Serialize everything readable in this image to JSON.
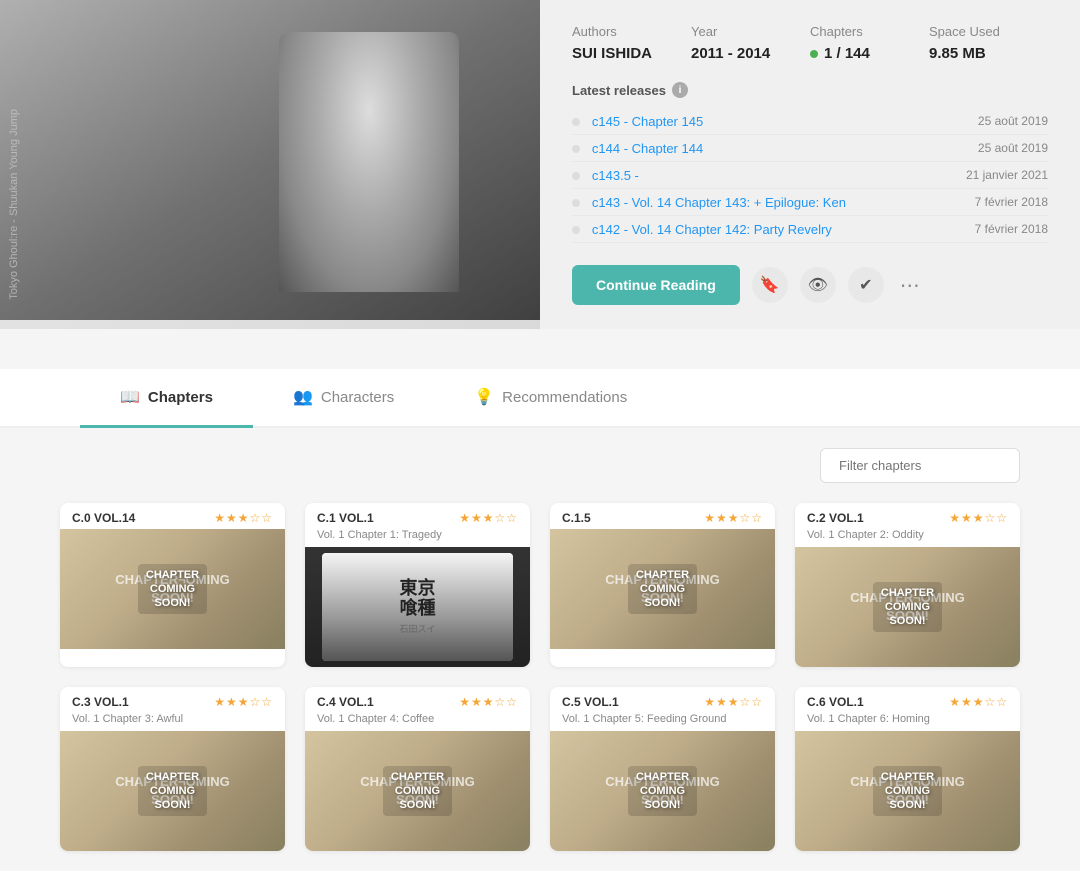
{
  "hero": {
    "cover_alt": "Tokyo Ghoul:re - Shuukan Young Jump",
    "cover_text": "Tokyo Ghoul:re - Shuukan Young Jump",
    "meta": {
      "authors_label": "Authors",
      "authors_value": "SUI ISHIDA",
      "year_label": "Year",
      "year_value": "2011 - 2014",
      "chapters_label": "Chapters",
      "chapters_value": "1 / 144",
      "space_label": "Space Used",
      "space_value": "9.85 MB"
    },
    "latest_releases_label": "Latest releases",
    "releases": [
      {
        "id": "c145",
        "label": "c145 - Chapter 145",
        "date": "25 août 2019"
      },
      {
        "id": "c144",
        "label": "c144 - Chapter 144",
        "date": "25 août 2019"
      },
      {
        "id": "c143_5",
        "label": "c143.5 -",
        "date": "21 janvier 2021"
      },
      {
        "id": "c143",
        "label": "c143 - Vol. 14 Chapter 143: + Epilogue: Ken",
        "date": "7 février 2018"
      },
      {
        "id": "c142",
        "label": "c142 - Vol. 14 Chapter 142: Party Revelry",
        "date": "7 février 2018"
      }
    ],
    "continue_reading_label": "Continue Reading",
    "more_options": "⋯"
  },
  "tabs": [
    {
      "id": "chapters",
      "label": "Chapters",
      "icon": "📖",
      "active": true
    },
    {
      "id": "characters",
      "label": "Characters",
      "icon": "👥",
      "active": false
    },
    {
      "id": "recommendations",
      "label": "Recommendations",
      "icon": "💡",
      "active": false
    }
  ],
  "filter_placeholder": "Filter chapters",
  "chapters": [
    {
      "num": "C.0 VOL.14",
      "title": "",
      "stars": "★★★☆☆",
      "type": "coming_soon"
    },
    {
      "num": "C.1 VOL.1",
      "title": "Vol. 1 Chapter 1: Tragedy",
      "stars": "★★★☆☆",
      "type": "manga_cover"
    },
    {
      "num": "C.1.5",
      "title": "",
      "stars": "★★★☆☆",
      "type": "coming_soon"
    },
    {
      "num": "C.2 VOL.1",
      "title": "Vol. 1 Chapter 2: Oddity",
      "stars": "★★★☆☆",
      "type": "coming_soon"
    },
    {
      "num": "C.3 VOL.1",
      "title": "Vol. 1 Chapter 3: Awful",
      "stars": "★★★☆☆",
      "type": "coming_soon"
    },
    {
      "num": "C.4 VOL.1",
      "title": "Vol. 1 Chapter 4: Coffee",
      "stars": "★★★☆☆",
      "type": "coming_soon"
    },
    {
      "num": "C.5 VOL.1",
      "title": "Vol. 1 Chapter 5: Feeding Ground",
      "stars": "★★★☆☆",
      "type": "coming_soon"
    },
    {
      "num": "C.6 VOL.1",
      "title": "Vol. 1 Chapter 6: Homing",
      "stars": "★★★☆☆",
      "type": "coming_soon"
    }
  ],
  "manga_cover_title": "東京\n喰種",
  "manga_cover_subtitle": "sui ishida"
}
